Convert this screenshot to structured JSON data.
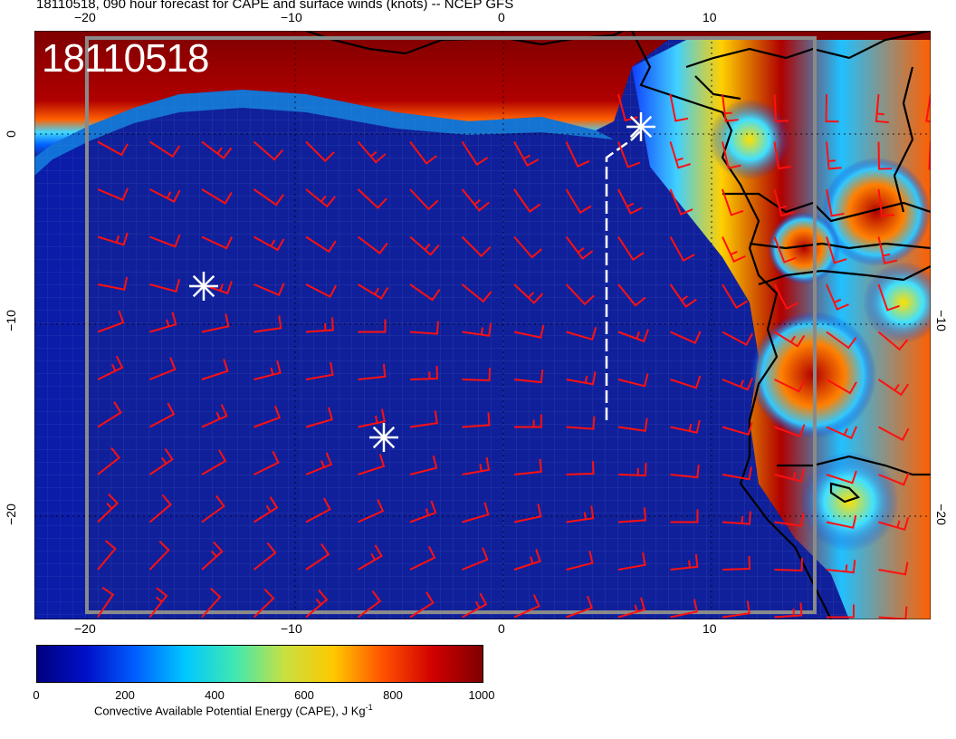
{
  "title": "18110518, 090 hour forecast for CAPE and surface winds (knots) -- NCEP GFS",
  "stamp": "18110518",
  "axes": {
    "top_ticks": [
      "−20",
      "−10",
      "0",
      "10"
    ],
    "bottom_ticks": [
      "−20",
      "−10",
      "0",
      "10"
    ],
    "left_ticks": [
      "0",
      "−10",
      "−20"
    ],
    "right_ticks": [
      "−10",
      "−20"
    ]
  },
  "colorbar": {
    "title": "Convective Available Potential Energy (CAPE), J Kg",
    "title_sup": "-1",
    "labels": [
      "0",
      "200",
      "400",
      "600",
      "800",
      "1000"
    ],
    "stops": [
      "#00007f",
      "#0010c8",
      "#0060ff",
      "#00c8ff",
      "#40e8b0",
      "#c8e040",
      "#ffc800",
      "#ff5000",
      "#d00000",
      "#7f0000"
    ]
  },
  "markers": {
    "count": 3,
    "color": "#ffffff"
  },
  "colors": {
    "ocean": "#10209a",
    "barb": "#ff1010",
    "coast": "#000000",
    "grid": "#9aa6d8"
  }
}
